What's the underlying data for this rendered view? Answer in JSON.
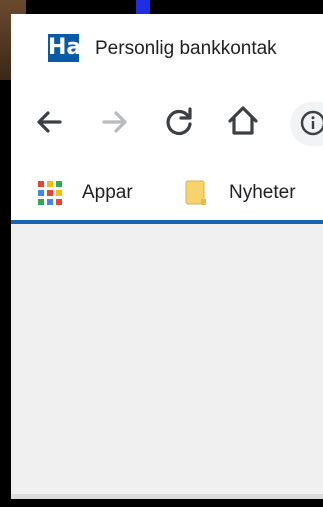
{
  "tab": {
    "favicon_text": "Ha",
    "title": "Personlig bankkontak"
  },
  "toolbar": {
    "back_icon": "arrow-left-icon",
    "forward_icon": "arrow-right-icon",
    "reload_icon": "reload-icon",
    "home_icon": "home-icon",
    "site_info_icon": "info-icon"
  },
  "bookmarks": {
    "apps_label": "Appar",
    "news_label": "Nyheter"
  },
  "colors": {
    "accent": "#1565b0",
    "favicon_bg": "#0b5aa5",
    "folder": "#f7d36b"
  }
}
